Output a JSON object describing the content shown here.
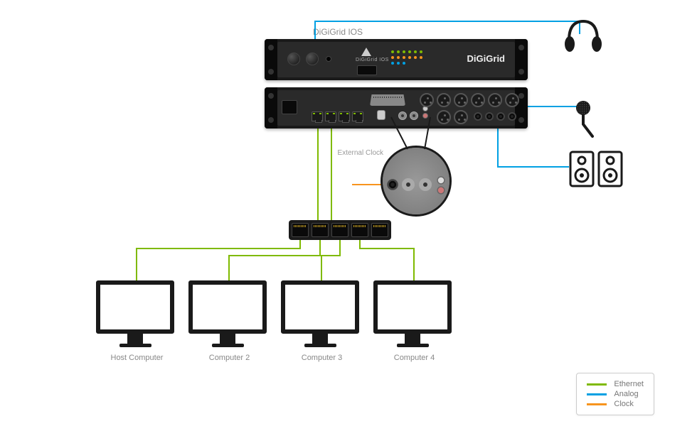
{
  "title": "DiGiGrid IOS",
  "device": {
    "brand": "DiGiGrid",
    "model_label": "DiGiGrid IOS"
  },
  "callout": {
    "label": "External Clock"
  },
  "computers": [
    {
      "label": "Host Computer"
    },
    {
      "label": "Computer 2"
    },
    {
      "label": "Computer 3"
    },
    {
      "label": "Computer 4"
    }
  ],
  "legend": {
    "ethernet": {
      "label": "Ethernet",
      "color": "#7fba00"
    },
    "analog": {
      "label": "Analog",
      "color": "#00a0e3"
    },
    "clock": {
      "label": "Clock",
      "color": "#f7941e"
    }
  },
  "peripherals": {
    "headphones": "headphones-icon",
    "microphone": "microphone-icon",
    "speakers": "speakers-icon"
  },
  "hub": {
    "ports": 5
  },
  "colors": {
    "ethernet": "#7fba00",
    "analog": "#00a0e3",
    "clock": "#f7941e"
  }
}
